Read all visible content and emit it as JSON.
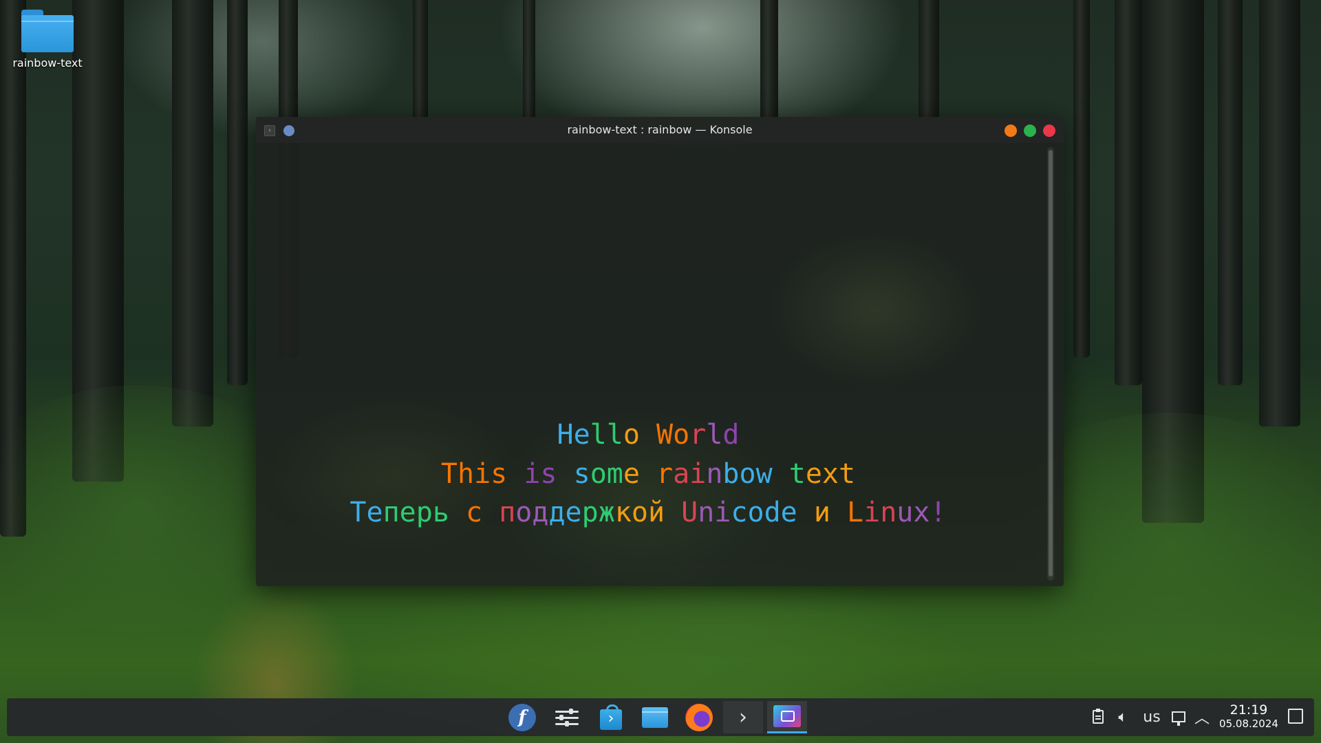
{
  "desktop": {
    "icon_label": "rainbow-text"
  },
  "window": {
    "title": "rainbow-text : rainbow — Konsole",
    "colors": {
      "minimize": "#f27a16",
      "maximize": "#2bb24c",
      "close": "#e8384a",
      "pin": "#6a8cc4"
    }
  },
  "terminal": {
    "lines": [
      [
        {
          "t": "H",
          "c": "#3daee9"
        },
        {
          "t": "e",
          "c": "#3daee9"
        },
        {
          "t": "l",
          "c": "#2ecc71"
        },
        {
          "t": "l",
          "c": "#2ecc71"
        },
        {
          "t": "o",
          "c": "#f39c12"
        },
        {
          "t": " ",
          "c": "#ffffff"
        },
        {
          "t": "W",
          "c": "#f67400"
        },
        {
          "t": "o",
          "c": "#f67400"
        },
        {
          "t": "r",
          "c": "#da4453"
        },
        {
          "t": "l",
          "c": "#9b59b6"
        },
        {
          "t": "d",
          "c": "#8e44ad"
        }
      ],
      [
        {
          "t": "This",
          "c": "#f67400"
        },
        {
          "t": " ",
          "c": "#ffffff"
        },
        {
          "t": "is",
          "c": "#8e44ad"
        },
        {
          "t": " ",
          "c": "#ffffff"
        },
        {
          "t": "s",
          "c": "#3daee9"
        },
        {
          "t": "om",
          "c": "#2ecc71"
        },
        {
          "t": "e",
          "c": "#f39c12"
        },
        {
          "t": " ",
          "c": "#ffffff"
        },
        {
          "t": "r",
          "c": "#f67400"
        },
        {
          "t": "ai",
          "c": "#da4453"
        },
        {
          "t": "n",
          "c": "#9b59b6"
        },
        {
          "t": "bow",
          "c": "#3daee9"
        },
        {
          "t": " ",
          "c": "#ffffff"
        },
        {
          "t": "t",
          "c": "#2ecc71"
        },
        {
          "t": "ext",
          "c": "#f39c12"
        }
      ],
      [
        {
          "t": "Те",
          "c": "#3daee9"
        },
        {
          "t": "перь",
          "c": "#2ecc71"
        },
        {
          "t": " ",
          "c": "#ffffff"
        },
        {
          "t": "с",
          "c": "#f67400"
        },
        {
          "t": " ",
          "c": "#ffffff"
        },
        {
          "t": "п",
          "c": "#da4453"
        },
        {
          "t": "од",
          "c": "#9b59b6"
        },
        {
          "t": "де",
          "c": "#3daee9"
        },
        {
          "t": "рж",
          "c": "#2ecc71"
        },
        {
          "t": "кой",
          "c": "#f39c12"
        },
        {
          "t": " ",
          "c": "#ffffff"
        },
        {
          "t": "U",
          "c": "#da4453"
        },
        {
          "t": "ni",
          "c": "#9b59b6"
        },
        {
          "t": "code",
          "c": "#3daee9"
        },
        {
          "t": " ",
          "c": "#ffffff"
        },
        {
          "t": "и",
          "c": "#f39c12"
        },
        {
          "t": " ",
          "c": "#ffffff"
        },
        {
          "t": "L",
          "c": "#f67400"
        },
        {
          "t": "in",
          "c": "#da4453"
        },
        {
          "t": "ux",
          "c": "#9b59b6"
        },
        {
          "t": "!",
          "c": "#8e44ad"
        }
      ]
    ]
  },
  "taskbar": {
    "apps": [
      {
        "name": "fedora-launcher",
        "icon": "fedora-logo-icon"
      },
      {
        "name": "system-settings",
        "icon": "settings-sliders-icon"
      },
      {
        "name": "discover",
        "icon": "shopping-bag-icon"
      },
      {
        "name": "dolphin-files",
        "icon": "folder-icon"
      },
      {
        "name": "firefox",
        "icon": "firefox-icon"
      },
      {
        "name": "konsole",
        "icon": "terminal-prompt-icon",
        "glyph": "›"
      },
      {
        "name": "spectacle",
        "icon": "screenshot-icon"
      }
    ],
    "tray": {
      "keyboard_layout": "us",
      "time": "21:19",
      "date": "05.08.2024"
    },
    "accent": "#3daee9"
  }
}
